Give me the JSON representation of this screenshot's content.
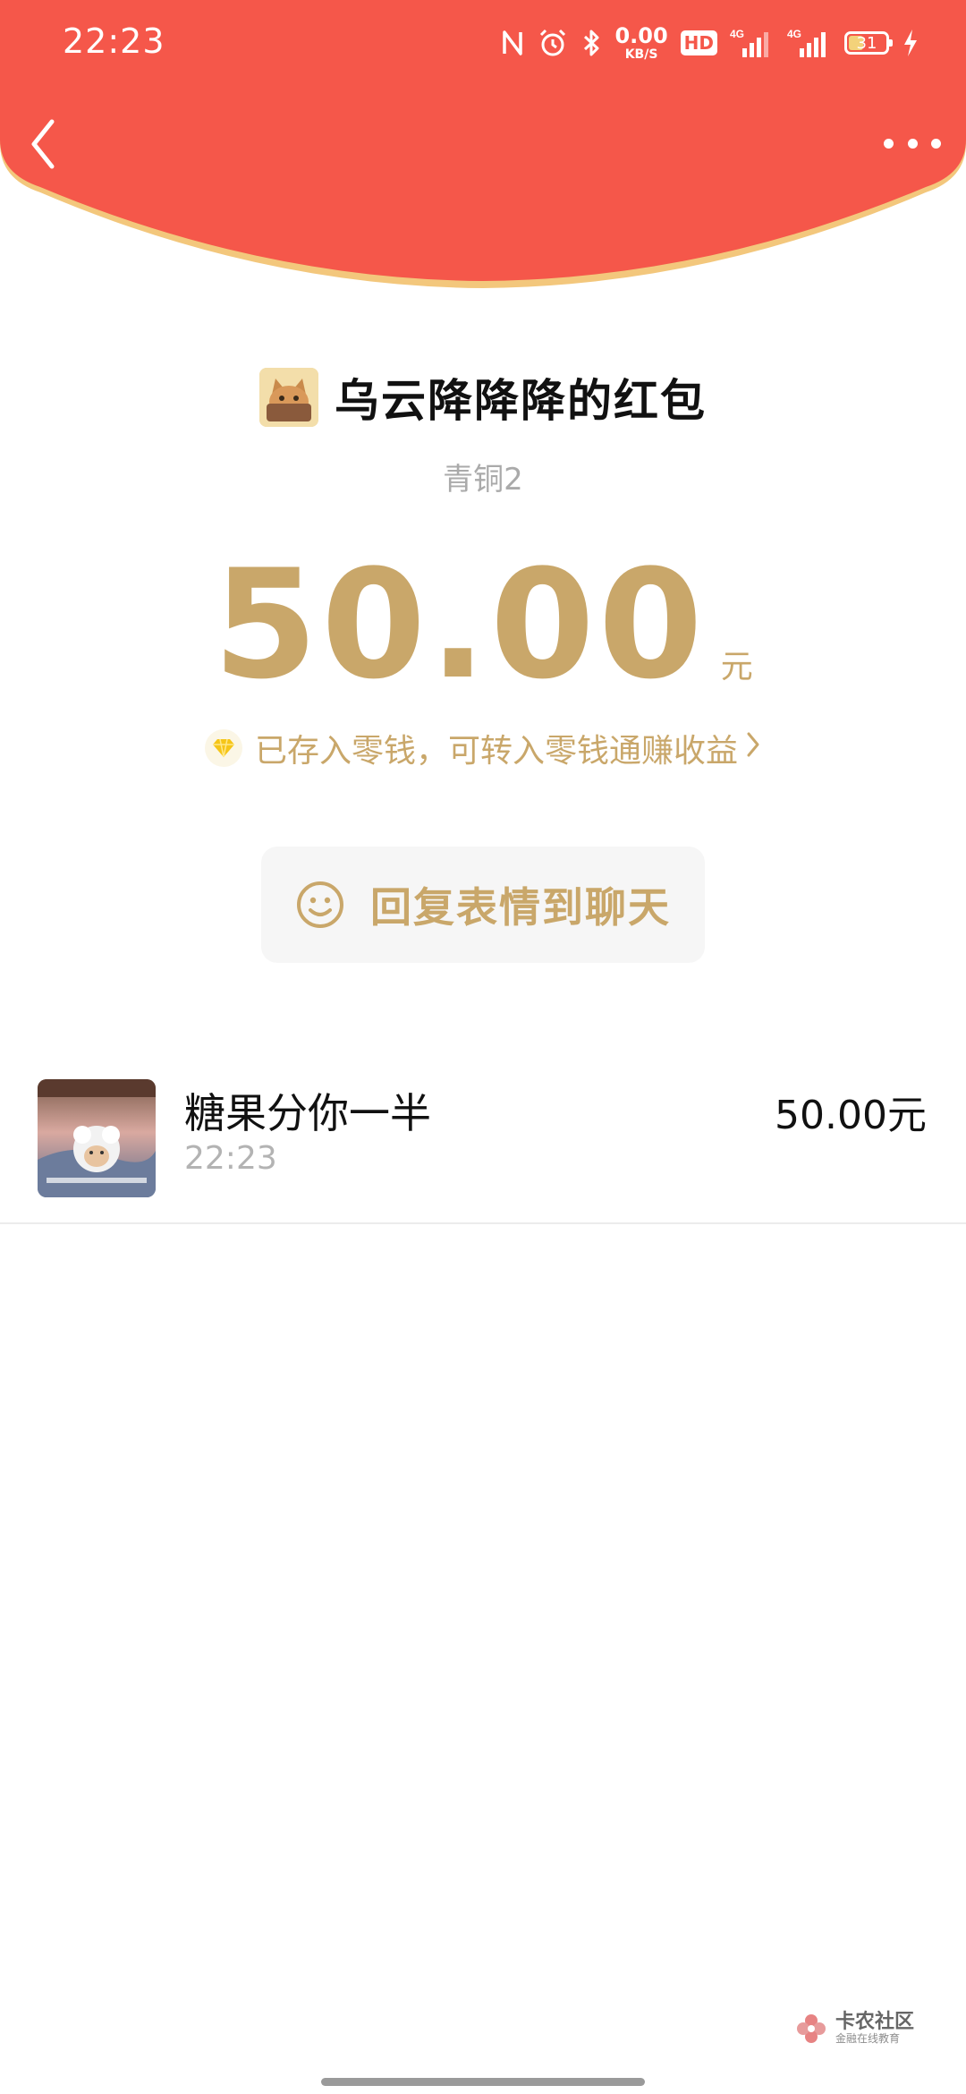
{
  "colors": {
    "header_red": "#f5574a",
    "header_rim": "#f3c77c",
    "gold": "#c9a76a",
    "text_dark": "#111111",
    "text_gray": "#aaaaaa"
  },
  "status_bar": {
    "time": "22:23",
    "net_speed_value": "0.00",
    "net_speed_unit": "KB/S",
    "hd_badge": "HD",
    "signal_label_1": "4G",
    "signal_label_2": "4G",
    "battery_level": "31",
    "icons": [
      "nfc-icon",
      "alarm-icon",
      "bluetooth-icon",
      "signal-icon",
      "battery-icon",
      "charging-icon"
    ]
  },
  "nav": {
    "back_icon": "chevron-left-icon",
    "more_icon": "more-dots-icon"
  },
  "red_packet": {
    "sender_title": "乌云降降降的红包",
    "level": "青铜2",
    "amount": "50.00",
    "unit": "元",
    "saved_text": "已存入零钱，可转入零钱通赚收益",
    "saved_arrow": "›",
    "reply_button": "回复表情到聊天"
  },
  "records": [
    {
      "name": "糖果分你一半",
      "time": "22:23",
      "amount": "50.00元"
    }
  ],
  "watermark": {
    "title": "卡农社区",
    "subtitle": "金融在线教育"
  }
}
